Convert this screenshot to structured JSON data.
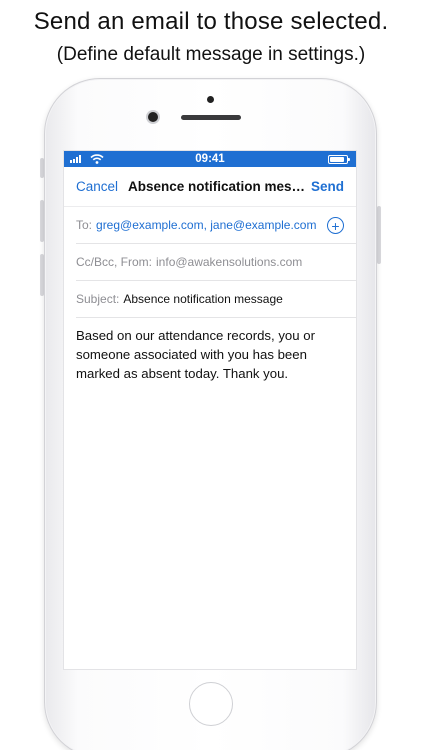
{
  "caption": {
    "line1": "Send an email to those selected.",
    "line2": "(Define default message in settings.)"
  },
  "statusbar": {
    "time": "09:41",
    "icons": [
      "signal-icon",
      "wifi-icon",
      "battery-icon"
    ],
    "battery_level": 0.85
  },
  "navbar": {
    "cancel_label": "Cancel",
    "title": "Absence notification message",
    "send_label": "Send"
  },
  "fields": {
    "to_label": "To:",
    "to_value": "greg@example.com, jane@example.com",
    "add_icon": "plus-circle-icon",
    "ccbcc_label": "Cc/Bcc, From:",
    "from_value": "info@awakensolutions.com",
    "subject_label": "Subject:",
    "subject_value": "Absence notification message"
  },
  "body": {
    "text": "Based on our attendance records, you or someone associated with you has been marked as absent today. Thank you."
  },
  "colors": {
    "accent": "#1f6fd2",
    "statusbar": "#1f6fd2",
    "label_gray": "#8e8e93"
  }
}
